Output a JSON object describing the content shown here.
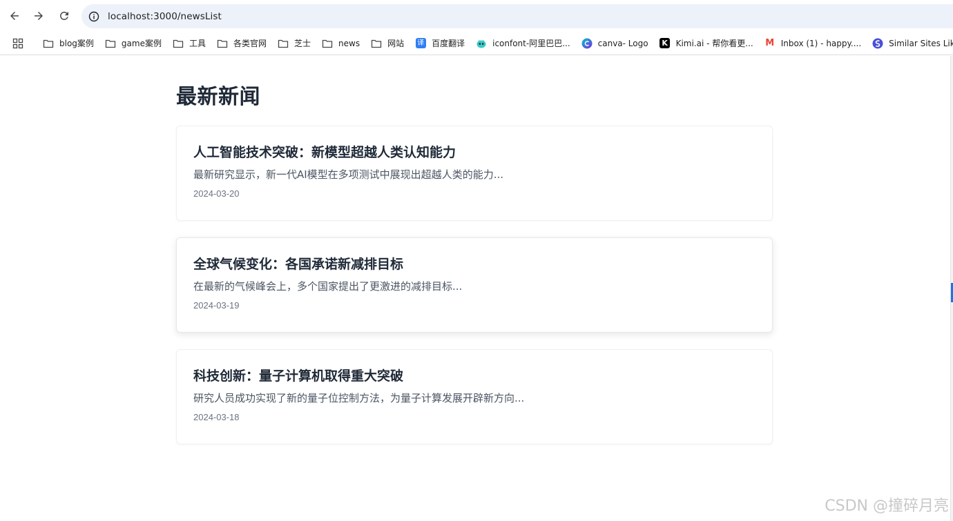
{
  "browser": {
    "url": "localhost:3000/newsList",
    "bookmarks": [
      {
        "label": "blog案例",
        "icon": "folder-icon"
      },
      {
        "label": "game案例",
        "icon": "folder-icon"
      },
      {
        "label": "工具",
        "icon": "folder-icon"
      },
      {
        "label": "各类官网",
        "icon": "folder-icon"
      },
      {
        "label": "芝士",
        "icon": "folder-icon"
      },
      {
        "label": "news",
        "icon": "folder-icon"
      },
      {
        "label": "网站",
        "icon": "folder-icon"
      },
      {
        "label": "百度翻译",
        "icon": "baidu-translate-icon",
        "badge": "译"
      },
      {
        "label": "iconfont-阿里巴巴...",
        "icon": "iconfont-icon"
      },
      {
        "label": "canva- Logo",
        "icon": "canva-icon"
      },
      {
        "label": "Kimi.ai - 帮你看更...",
        "icon": "kimi-icon",
        "badge": "K"
      },
      {
        "label": "Inbox (1) - happy....",
        "icon": "gmail-icon",
        "badge": "M"
      },
      {
        "label": "Similar Sites Lik",
        "icon": "similar-sites-icon"
      }
    ]
  },
  "page": {
    "title": "最新新闻"
  },
  "news": [
    {
      "title": "人工智能技术突破：新模型超越人类认知能力",
      "summary": "最新研究显示，新一代AI模型在多项测试中展现出超越人类的能力...",
      "date": "2024-03-20"
    },
    {
      "title": "全球气候变化：各国承诺新减排目标",
      "summary": "在最新的气候峰会上，多个国家提出了更激进的减排目标...",
      "date": "2024-03-19"
    },
    {
      "title": "科技创新：量子计算机取得重大突破",
      "summary": "研究人员成功实现了新的量子位控制方法，为量子计算发展开辟新方向...",
      "date": "2024-03-18"
    }
  ],
  "watermark": "CSDN @撞碎月亮",
  "colors": {
    "omnibox": "#edf2fa",
    "title": "#1f2937",
    "summary": "#4b5563",
    "date": "#6b7280",
    "gmail_red": "#ea4335",
    "canva": "#00c4cc"
  }
}
